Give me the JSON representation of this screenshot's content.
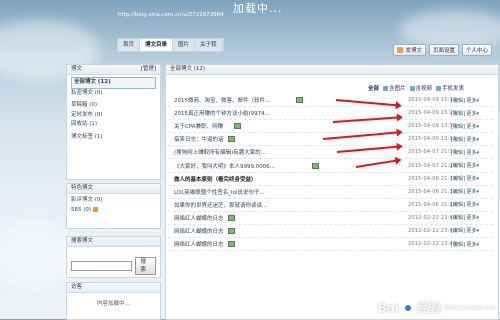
{
  "header": {
    "title": "加载中...",
    "url": "http://blog.sina.com.cn/u/2722973984"
  },
  "nav": {
    "items": [
      "首页",
      "博文目录",
      "图片",
      "关于我"
    ],
    "active_index": 1
  },
  "top_buttons": {
    "publish": "发博文",
    "page_settings": "页面设置",
    "personal_center": "个人中心"
  },
  "sidebar": {
    "category_panel": {
      "title": "博文",
      "manage": "[管理]",
      "items": [
        "全部博文 (12)",
        "私密博文 (0)",
        "草稿箱 (0)",
        "定时发布 (0)",
        "回收站 (1)",
        "博文标签 (1)"
      ]
    },
    "special_panel": {
      "title": "特色博文",
      "items": [
        "影评博文 (0)",
        "565 (0)"
      ]
    },
    "search_panel": {
      "title": "搜索博文",
      "search_label": "搜索"
    },
    "visitors_panel": {
      "title": "访客",
      "body": "内容加载中..."
    }
  },
  "main": {
    "panel_title": "全部博文 (12)",
    "toolbar": {
      "all": "全部",
      "pictures": "含图片",
      "video": "含视频",
      "mobile": "手机发表"
    },
    "posts": [
      {
        "title": "2015微商、淘宝、微客、邮件（软件...",
        "date": "2015-04-09 15:12",
        "action": "[编辑] 更多▾",
        "bold": false,
        "pic": true
      },
      {
        "title": "2015真正用赚的个钟方法小结(9974...",
        "date": "2015-04-09 15:20",
        "action": "[编辑] 更多▾",
        "bold": false,
        "pic": false
      },
      {
        "title": "关于CPA兼职、网赚",
        "date": "2015-04-09 13:30",
        "action": "[编辑] 更多▾",
        "bold": false,
        "pic": true
      },
      {
        "title": "搞笑日志：牛逼的话",
        "date": "2015-04-09 13:13",
        "action": "[编辑] 更多▾",
        "bold": false,
        "pic": true
      },
      {
        "title": "(搜狗网上赚取所有编辑)有趣大家的...",
        "date": "2015-04-07 21:37",
        "action": "[编辑] 更多▾",
        "bold": false,
        "pic": false
      },
      {
        "title": "《大家好，我叫大明》本人9999.0006...",
        "date": "2015-04-07 21:28",
        "action": "[编辑] 更多▾",
        "bold": false,
        "pic": true
      },
      {
        "title": "做人的基本原则（看完终身受益）",
        "date": "2015-04-06 21:37",
        "action": "[编辑] 更多▾",
        "bold": true,
        "pic": false
      },
      {
        "title": "LOL英雄联盟个性签名_lol说说句子...",
        "date": "2015-04-06 21:32",
        "action": "[编辑] 更多▾",
        "bold": false,
        "pic": false
      },
      {
        "title": "如果你的世界还迷茫，那就请你读读...",
        "date": "2015-04-06 21:20",
        "action": "[编辑] 更多▾",
        "bold": false,
        "pic": false
      },
      {
        "title": "网络红人蝴蝶的日志",
        "date": "2012-02-22 23:40",
        "action": "[编辑] 更多▾",
        "bold": false,
        "pic": true
      },
      {
        "title": "网络红人蝴蝶的日志",
        "date": "2012-02-22 23:40",
        "action": "[编辑] 更多▾",
        "bold": false,
        "pic": true
      },
      {
        "title": "网络红人蝴蝶的日志",
        "date": "2012-02-22 23:40",
        "action": "[编辑] 更多▾",
        "bold": false,
        "pic": true
      }
    ]
  },
  "watermark": {
    "brand": "Bai",
    "brand2": "经验",
    "sub": "jingyan.baidu.com"
  },
  "colors": {
    "arrow": "#e0141c",
    "link": "#345"
  }
}
